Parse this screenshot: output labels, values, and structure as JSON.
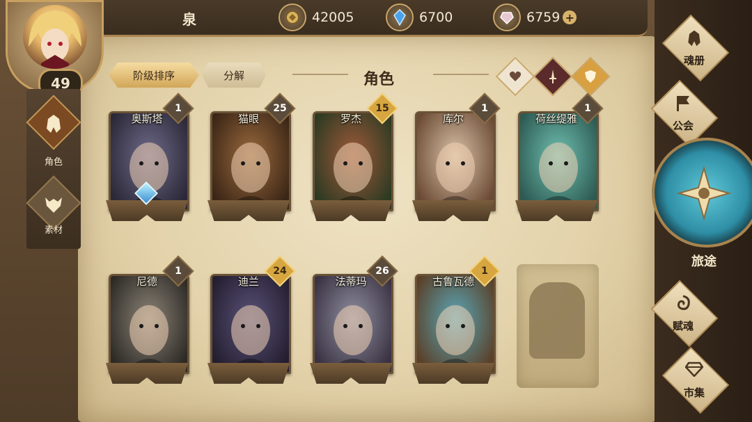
{
  "header": {
    "player_name": "泉",
    "level": "49",
    "currencies": [
      {
        "icon": "gold-coin-icon",
        "value": "42005"
      },
      {
        "icon": "blue-crystal-icon",
        "value": "6700"
      },
      {
        "icon": "pink-gem-icon",
        "value": "6759",
        "add": "+"
      }
    ]
  },
  "left_tabs": [
    {
      "label": "角色",
      "icon": "helmet-icon",
      "active": true
    },
    {
      "label": "素材",
      "icon": "beast-skull-icon",
      "active": false
    }
  ],
  "toolbar": {
    "sort_label": "阶级排序",
    "decompose_label": "分解",
    "title": "角色",
    "filters": [
      {
        "icon": "heart-icon",
        "color": "#efe4cf"
      },
      {
        "icon": "sword-icon",
        "color": "#5b2a2a"
      },
      {
        "icon": "shield-icon",
        "color": "#d8a040"
      }
    ]
  },
  "characters": [
    {
      "name": "奥斯塔",
      "badge": "1",
      "badge_style": "grey",
      "palette": [
        "#6f6b8a",
        "#2b2838"
      ],
      "gem": true
    },
    {
      "name": "猫眼",
      "badge": "25",
      "badge_style": "grey",
      "palette": [
        "#9b6a3d",
        "#3b2616"
      ],
      "gem": false
    },
    {
      "name": "罗杰",
      "badge": "15",
      "badge_style": "gold",
      "palette": [
        "#a05a3a",
        "#2c3a22"
      ],
      "gem": false
    },
    {
      "name": "库尔",
      "badge": "1",
      "badge_style": "grey",
      "palette": [
        "#d9c2a8",
        "#6b4a34"
      ],
      "gem": false
    },
    {
      "name": "荷丝缇雅",
      "badge": "1",
      "badge_style": "grey",
      "palette": [
        "#6fc0b0",
        "#2d5a52"
      ],
      "gem": false
    },
    {
      "name": "尼德",
      "badge": "1",
      "badge_style": "grey",
      "palette": [
        "#8c8478",
        "#2d2a25"
      ],
      "gem": false
    },
    {
      "name": "迪兰",
      "badge": "24",
      "badge_style": "gold",
      "palette": [
        "#5a5278",
        "#241e30"
      ],
      "gem": false
    },
    {
      "name": "法蒂玛",
      "badge": "26",
      "badge_style": "grey",
      "palette": [
        "#8f8fa0",
        "#3a3242"
      ],
      "gem": false
    },
    {
      "name": "古鲁瓦德",
      "badge": "1",
      "badge_style": "gold",
      "palette": [
        "#5aa7b8",
        "#5a4028"
      ],
      "gem": false
    }
  ],
  "right_menu": {
    "soul_book": "魂册",
    "guild": "公会",
    "journey": "旅途",
    "empower": "赋魂",
    "market": "市集"
  }
}
